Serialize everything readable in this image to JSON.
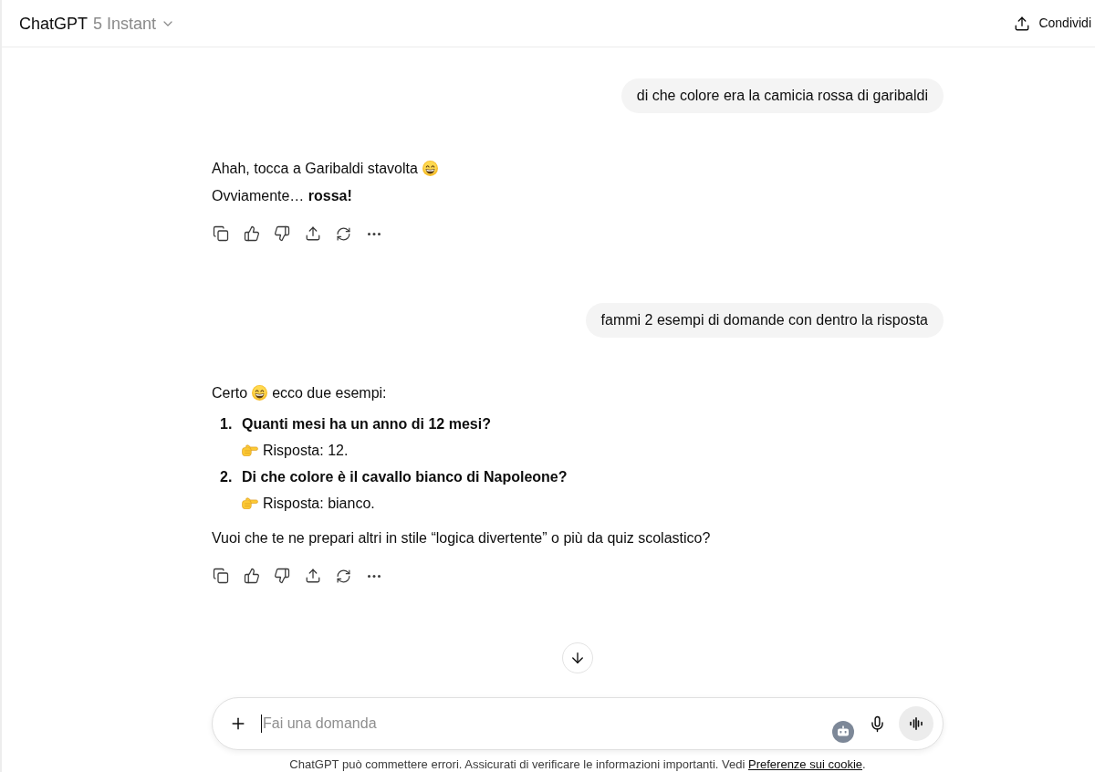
{
  "header": {
    "title": "ChatGPT",
    "model": "5 Instant",
    "share_label": "Condividi"
  },
  "messages": [
    {
      "kind": "user",
      "text": "di che colore era la camicia rossa di garibaldi"
    },
    {
      "kind": "assistant",
      "blocks": [
        {
          "kind": "paragraph",
          "parts": [
            {
              "kind": "text",
              "text": "Ahah, tocca a Garibaldi stavolta"
            },
            {
              "kind": "grin_emoji"
            }
          ]
        },
        {
          "kind": "paragraph",
          "parts": [
            {
              "kind": "text",
              "text": "Ovviamente… **rossa!**"
            }
          ]
        }
      ]
    },
    {
      "kind": "user",
      "text": "fammi 2 esempi di domande con dentro la risposta"
    },
    {
      "kind": "assistant",
      "blocks": [
        {
          "kind": "paragraph",
          "parts": [
            {
              "kind": "text",
              "text": "Certo"
            },
            {
              "kind": "grin_emoji"
            },
            {
              "kind": "text",
              "text": "ecco due esempi:"
            }
          ]
        },
        {
          "kind": "ordered_list",
          "items": [
            {
              "number": "1.",
              "question": "Quanti mesi ha un anno di 12 mesi?",
              "answer": [
                {
                  "kind": "pointing_emoji"
                },
                {
                  "kind": "text",
                  "text": "Risposta: 12."
                }
              ]
            },
            {
              "number": "2.",
              "question": "Di che colore è il cavallo bianco di Napoleone?",
              "answer": [
                {
                  "kind": "pointing_emoji"
                },
                {
                  "kind": "text",
                  "text": "Risposta: bianco."
                }
              ]
            }
          ]
        },
        {
          "kind": "paragraph",
          "parts": [
            {
              "kind": "text",
              "text": "Vuoi che te ne prepari altri in stile “logica divertente” o più da quiz scolastico?"
            }
          ]
        }
      ]
    }
  ],
  "composer": {
    "placeholder": "Fai una domanda",
    "focused": true
  },
  "disclaimer": {
    "text": "ChatGPT può commettere errori. Assicurati di verificare le informazioni importanti. Vedi",
    "link": "Preferenze sui cookie",
    "end": "."
  }
}
